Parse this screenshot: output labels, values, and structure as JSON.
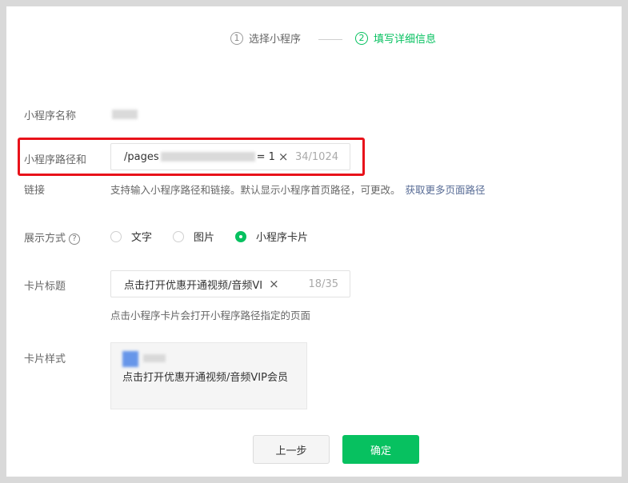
{
  "steps": [
    {
      "num": "1",
      "label": "选择小程序"
    },
    {
      "num": "2",
      "label": "填写详细信息"
    }
  ],
  "form": {
    "name_label": "小程序名称",
    "path_label_line1": "小程序路径和",
    "path_label_line2": "链接",
    "path_value_prefix": "/pages",
    "path_value_suffix": "= 1",
    "path_count": "34/1024",
    "path_hint": "支持输入小程序路径和链接。默认显示小程序首页路径，可更改。",
    "path_hint_link": "获取更多页面路径",
    "display_label": "展示方式",
    "help_glyph": "?",
    "display_options": [
      {
        "label": "文字",
        "checked": false
      },
      {
        "label": "图片",
        "checked": false
      },
      {
        "label": "小程序卡片",
        "checked": true
      }
    ],
    "card_title_label": "卡片标题",
    "card_title_value": "点击打开优惠开通视频/音频VI",
    "card_title_count": "18/35",
    "card_title_hint": "点击小程序卡片会打开小程序路径指定的页面",
    "card_style_label": "卡片样式",
    "card_preview_title": "点击打开优惠开通视频/音频VIP会员"
  },
  "buttons": {
    "prev": "上一步",
    "confirm": "确定"
  },
  "icons": {
    "clear": "×",
    "close-icon": "clear-icon"
  },
  "colors": {
    "accent": "#07c160",
    "link": "#576b95",
    "highlight": "#e8121a"
  }
}
